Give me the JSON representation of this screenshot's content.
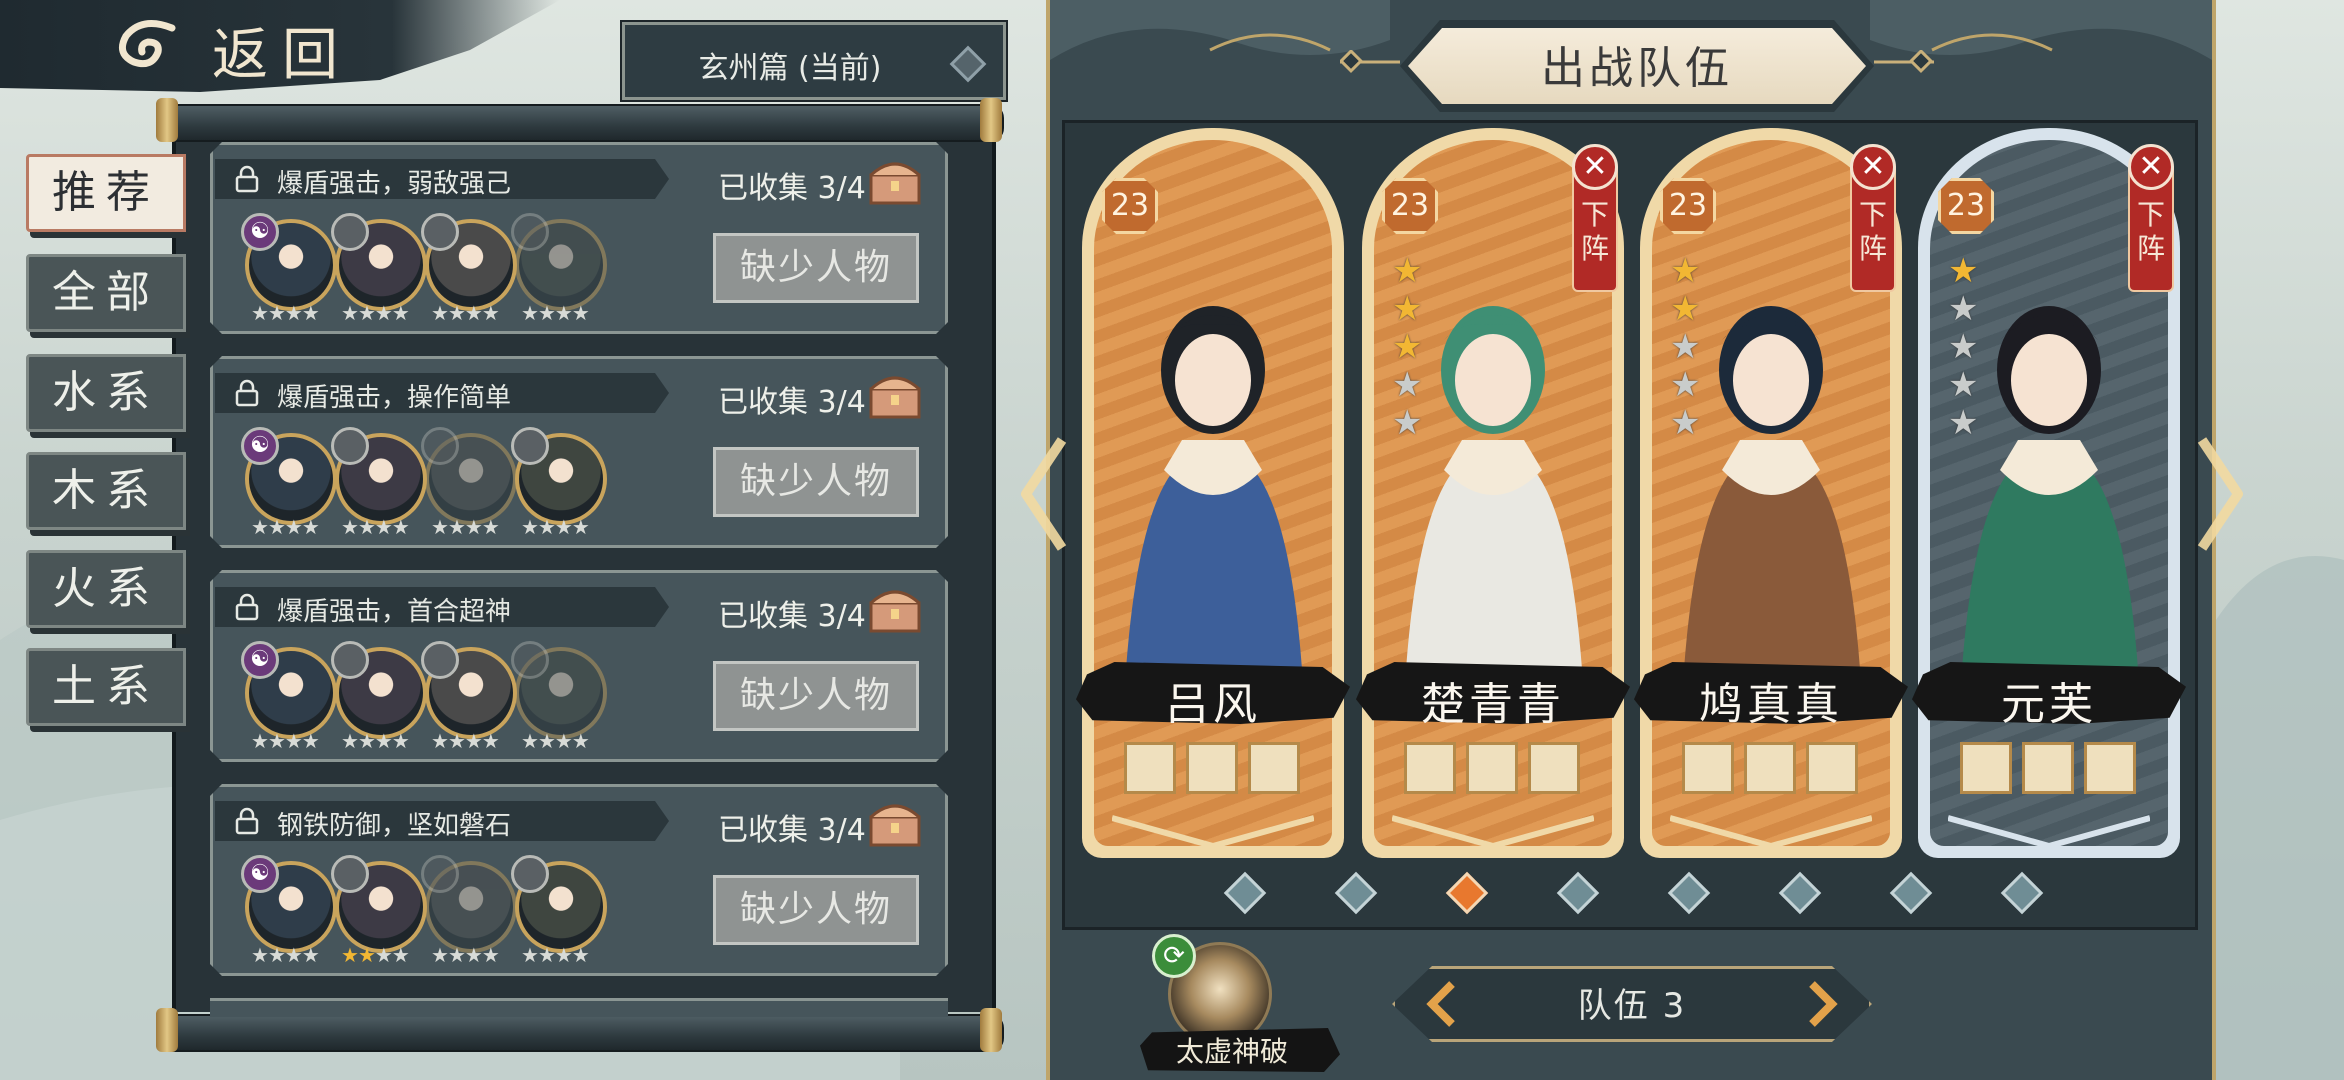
{
  "header": {
    "back_label": "返回"
  },
  "chapter_select": {
    "label": "玄州篇 (当前)"
  },
  "categories": [
    {
      "label": "推荐",
      "active": true
    },
    {
      "label": "全部",
      "active": false
    },
    {
      "label": "水系",
      "active": false
    },
    {
      "label": "木系",
      "active": false
    },
    {
      "label": "火系",
      "active": false
    },
    {
      "label": "土系",
      "active": false
    }
  ],
  "recommended_teams": [
    {
      "title": "爆盾强击，弱敌强己",
      "collected": "已收集 3/4",
      "button": "缺少人物",
      "stars": [
        0,
        0,
        0,
        0
      ],
      "missing_index": 3
    },
    {
      "title": "爆盾强击，操作简单",
      "collected": "已收集 3/4",
      "button": "缺少人物",
      "stars": [
        0,
        0,
        0,
        0
      ],
      "missing_index": 2
    },
    {
      "title": "爆盾强击，首合超神",
      "collected": "已收集 3/4",
      "button": "缺少人物",
      "stars": [
        0,
        0,
        0,
        0
      ],
      "missing_index": 3
    },
    {
      "title": "钢铁防御，坚如磐石",
      "collected": "已收集 3/4",
      "button": "缺少人物",
      "stars": [
        0,
        2,
        0,
        0
      ],
      "missing_index": 2
    }
  ],
  "team_panel": {
    "title": "出战队伍",
    "team_label": "队伍 3",
    "skill_label": "太虚神破",
    "active_page": 2,
    "page_count": 8
  },
  "heroes": [
    {
      "name": "吕风",
      "level": "23",
      "stars": 0,
      "removable": false,
      "theme": "orange"
    },
    {
      "name": "楚青青",
      "level": "23",
      "stars": 3,
      "removable": true,
      "theme": "orange"
    },
    {
      "name": "鸠真真",
      "level": "23",
      "stars": 2,
      "removable": true,
      "theme": "orange"
    },
    {
      "name": "元芙",
      "level": "23",
      "stars": 1,
      "removable": true,
      "theme": "blue"
    }
  ],
  "remove_label": "下阵",
  "colors": {
    "accent_orange": "#e8782e",
    "star_gold": "#f2b733",
    "remove_red": "#b12a26",
    "panel_dark": "#2b383d"
  }
}
